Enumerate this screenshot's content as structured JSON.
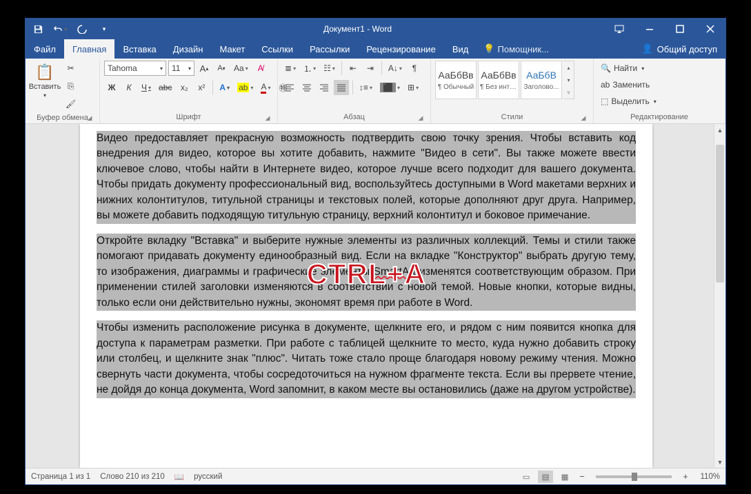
{
  "title": "Документ1 - Word",
  "tabs": {
    "file": "Файл",
    "home": "Главная",
    "insert": "Вставка",
    "design": "Дизайн",
    "layout": "Макет",
    "references": "Ссылки",
    "mailings": "Рассылки",
    "review": "Рецензирование",
    "view": "Вид",
    "tell_me": "Помощник...",
    "share": "Общий доступ"
  },
  "ribbon": {
    "clipboard": {
      "paste": "Вставить",
      "group": "Буфер обмена"
    },
    "font": {
      "group": "Шрифт",
      "family": "Tahoma",
      "size": "11",
      "bold": "Ж",
      "italic": "К",
      "underline": "Ч",
      "strike": "abc",
      "sub": "x₂",
      "sup": "x²"
    },
    "paragraph": {
      "group": "Абзац"
    },
    "styles": {
      "group": "Стили",
      "items": [
        {
          "preview": "АаБбВв",
          "name": "¶ Обычный"
        },
        {
          "preview": "АаБбВв",
          "name": "¶ Без инте..."
        },
        {
          "preview": "АаБбВ",
          "name": "Заголово..."
        }
      ]
    },
    "editing": {
      "group": "Редактирование",
      "find": "Найти",
      "replace": "Заменить",
      "select": "Выделить"
    }
  },
  "document": {
    "p1": "Видео предоставляет прекрасную возможность подтвердить свою точку зрения. Чтобы вставить код внедрения для видео, которое вы хотите добавить, нажмите \"Видео в сети\". Вы также можете ввести ключевое слово, чтобы найти в Интернете видео, которое лучше всего подходит для вашего документа. Чтобы придать документу профессиональный вид, воспользуйтесь доступными в Word макетами верхних и нижних колонтитулов, титульной страницы и текстовых полей, которые дополняют друг друга. Например, вы можете добавить подходящую титульную страницу, верхний колонтитул и боковое примечание.",
    "p2a": "Откройте вкладку \"Вставка\" и выберите нужные элементы из различных коллекций. Темы и стили также помогают придавать документу единообразный вид. Если на вкладке \"Конструктор\" выбрать другую тему, то изображения, диаграммы и графические элементы ",
    "p2b": "SmartArt",
    "p2c": " изменятся соответствующим образом. При применении стилей заголовки изменяются в соответствии с новой темой. Новые кнопки, которые видны, только если они действительно нужны, экономят время при работе в Word.",
    "p3": "Чтобы изменить расположение рисунка в документе, щелкните его, и рядом с ним появится кнопка для доступа к параметрам разметки. При работе с таблицей щелкните то место, куда нужно добавить строку или столбец, и щелкните знак \"плюс\". Читать тоже стало проще благодаря новому режиму чтения. Можно свернуть части документа, чтобы сосредоточиться на нужном фрагменте текста. Если вы прервете чтение, не дойдя до конца документа, Word запомнит, в каком месте вы остановились (даже на другом устройстве)."
  },
  "overlay": "CTRL+A",
  "status": {
    "page": "Страница 1 из 1",
    "words": "Слово 210 из 210",
    "lang": "русский",
    "zoom": "110%"
  }
}
